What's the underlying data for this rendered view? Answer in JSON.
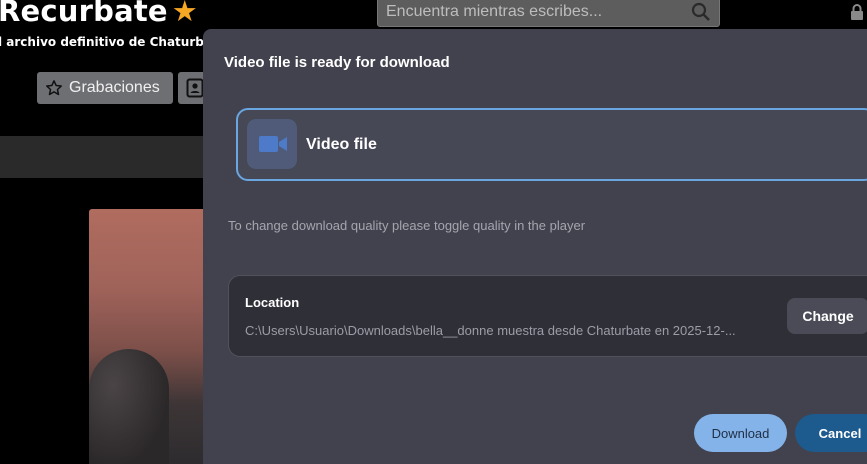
{
  "site": {
    "logo_text": "Recurbate",
    "logo_star": "★",
    "tagline": "l archivo definitivo de Chaturba",
    "search": {
      "placeholder": "Encuentra mientras escribes..."
    },
    "nav": {
      "recordings_label": "Grabaciones"
    },
    "icons": [
      "star-outline-icon",
      "contact-card-icon",
      "search-icon",
      "lock-icon"
    ],
    "accent_color": "#f5a623"
  },
  "dialog": {
    "title": "Video file is ready for download",
    "file_option": {
      "label": "Video file",
      "icon": "video-camera-icon"
    },
    "hint": "To change download quality please toggle quality in the player",
    "location": {
      "title": "Location",
      "path": "C:\\Users\\Usuario\\Downloads\\bella__donne muestra desde Chaturbate en 2025-12-...",
      "change_label": "Change"
    },
    "download_label": "Download",
    "cancel_label": "Cancel",
    "colors": {
      "background": "#42424e",
      "selected_border": "#6aa6e0",
      "download": "#84b3ea",
      "cancel": "#1d5a8e"
    }
  }
}
